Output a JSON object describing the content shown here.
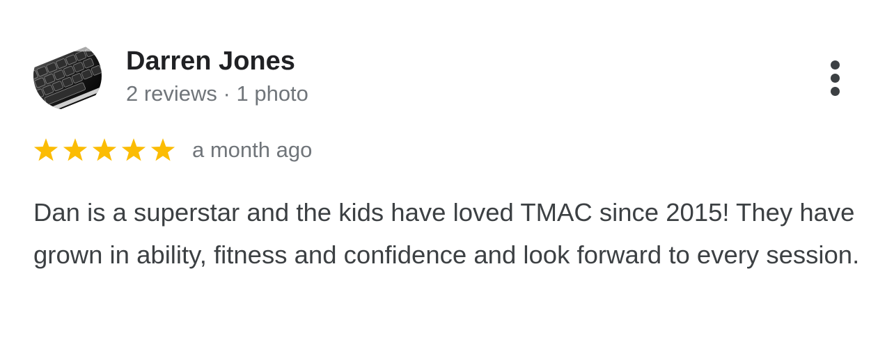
{
  "review": {
    "reviewer_name": "Darren Jones",
    "reviewer_meta": "2 reviews · 1 photo",
    "avatar_icon": "keyboard-photo-icon",
    "more_icon": "more-vert-icon",
    "rating": 5,
    "rating_max": 5,
    "time_ago": "a month ago",
    "text": "Dan is a superstar and the kids have loved TMAC since 2015! They have grown in ability, fitness and confidence and look forward to every session."
  },
  "colors": {
    "star": "#fbbc04",
    "name": "#202124",
    "meta": "#70757a",
    "body_text": "#3c4043",
    "more_dots": "#3c4043"
  }
}
